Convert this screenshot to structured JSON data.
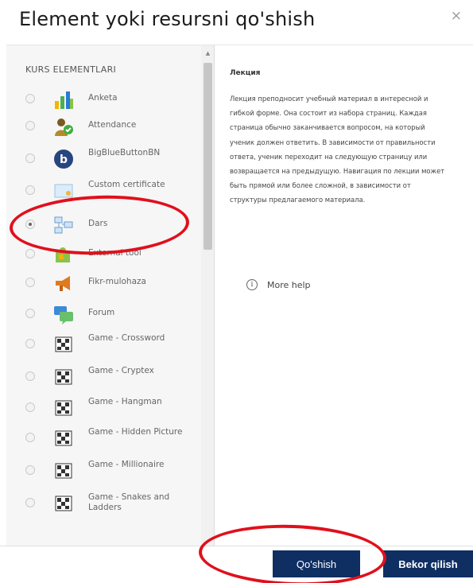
{
  "dialog": {
    "title": "Element yoki resursni qo'shish",
    "close_glyph": "×"
  },
  "left": {
    "section_title": "KURS ELEMENTLARI",
    "items": [
      {
        "label": "Anketa",
        "icon": "chart-icon",
        "selected": false
      },
      {
        "label": "Attendance",
        "icon": "attendance-icon",
        "selected": false
      },
      {
        "label": "BigBlueButtonBN",
        "icon": "bigbluebutton-icon",
        "selected": false
      },
      {
        "label": "Custom certificate",
        "icon": "certificate-icon",
        "selected": false
      },
      {
        "label": "Dars",
        "icon": "lesson-icon",
        "selected": true
      },
      {
        "label": "External tool",
        "icon": "puzzle-icon",
        "selected": false
      },
      {
        "label": "Fikr-mulohaza",
        "icon": "megaphone-icon",
        "selected": false
      },
      {
        "label": "Forum",
        "icon": "forum-icon",
        "selected": false
      },
      {
        "label": "Game - Crossword",
        "icon": "game-icon",
        "selected": false
      },
      {
        "label": "Game - Cryptex",
        "icon": "game-icon",
        "selected": false
      },
      {
        "label": "Game - Hangman",
        "icon": "game-icon",
        "selected": false
      },
      {
        "label": "Game - Hidden Picture",
        "icon": "game-icon",
        "selected": false
      },
      {
        "label": "Game - Millionaire",
        "icon": "game-icon",
        "selected": false
      },
      {
        "label": "Game - Snakes and Ladders",
        "icon": "game-icon",
        "selected": false
      }
    ]
  },
  "right": {
    "heading": "Лекция",
    "description": "Лекция преподносит учебный материал в интересной и гибкой форме. Она состоит из набора страниц. Каждая страница обычно заканчивается вопросом, на который ученик должен ответить. В зависимости от правильности ответа, ученик переходит на следующую страницу или возвращается на предыдущую. Навигация по лекции может быть прямой или более сложной, в зависимости от структуры предлагаемого материала.",
    "help_label": "More help",
    "help_glyph": "i"
  },
  "footer": {
    "add_label": "Qo'shish",
    "cancel_label": "Bekor qilish"
  },
  "colors": {
    "primary_button": "#0f2f63",
    "annotation": "#e0101c"
  }
}
